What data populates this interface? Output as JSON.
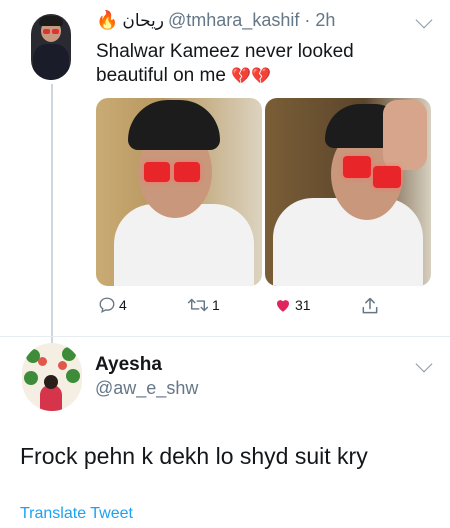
{
  "tweet": {
    "display_name": "ریحان",
    "handle_time": "@tmhara_kashif · 2h",
    "text": "Shalwar Kameez never looked beautiful on me",
    "heart_emoji": "💔💔",
    "fire_emoji": "🔥",
    "actions": {
      "reply_count": "4",
      "retweet_count": "1",
      "like_count": "31"
    },
    "colors": {
      "like": "#e0245e",
      "icon": "#657786"
    }
  },
  "reply": {
    "name": "Ayesha",
    "handle": "@aw_e_shw",
    "text": "Frock pehn k dekh lo shyd suit kry",
    "translate_label": "Translate Tweet",
    "colors": {
      "link": "#1da1f2"
    }
  }
}
